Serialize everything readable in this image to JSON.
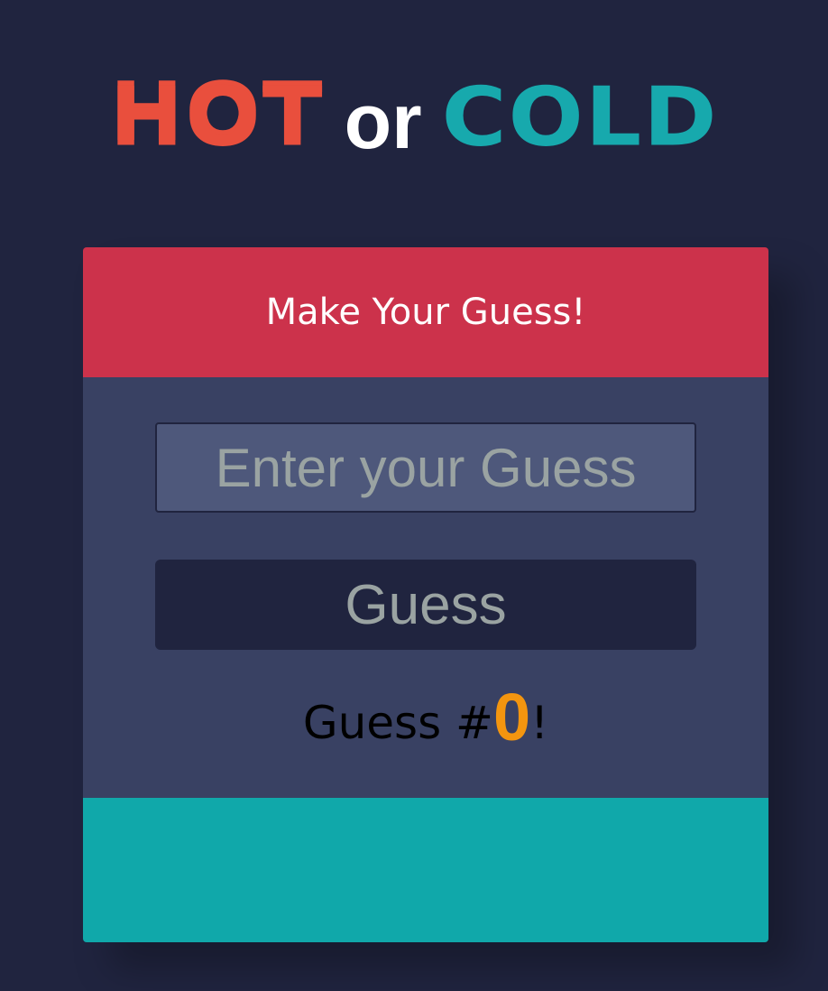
{
  "title": {
    "hot": "HOT",
    "or": "or",
    "cold": "COLD"
  },
  "card": {
    "header": "Make Your Guess!",
    "input_placeholder": "Enter your Guess",
    "input_value": "",
    "button_label": "Guess",
    "counter_prefix": "Guess #",
    "counter_value": "0",
    "counter_suffix": "!",
    "feedback": ""
  },
  "colors": {
    "background": "#20243f",
    "hot": "#e94f3d",
    "cold": "#17a9ad",
    "header": "#cc324b",
    "body": "#394163",
    "footer": "#10a8aa",
    "counter_accent": "#f3950f"
  }
}
